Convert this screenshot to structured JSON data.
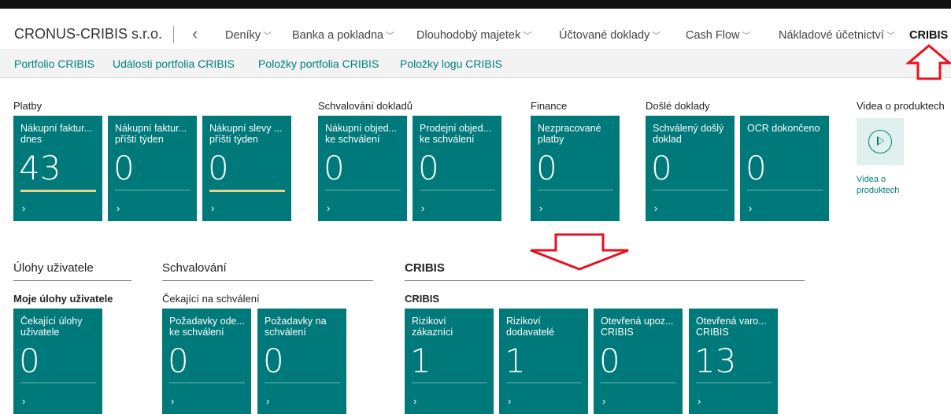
{
  "header": {
    "company": "CRONUS-CRIBIS s.r.o.",
    "back_icon": "chevron-left-icon",
    "menus": [
      {
        "label": "Deníky",
        "active": false
      },
      {
        "label": "Banka a pokladna",
        "active": false
      },
      {
        "label": "Dlouhodobý majetek",
        "active": false
      },
      {
        "label": "Účtované doklady",
        "active": false
      },
      {
        "label": "Cash Flow",
        "active": false
      },
      {
        "label": "Nákladové účetnictví",
        "active": false
      },
      {
        "label": "CRIBIS",
        "active": true
      }
    ]
  },
  "subnav": {
    "links": [
      "Portfolio CRIBIS",
      "Události portfolia CRIBIS",
      "Položky portfolia CRIBIS",
      "Položky logu CRIBIS"
    ]
  },
  "groups": {
    "platby": {
      "title": "Platby",
      "tiles": [
        {
          "label": "Nákupní faktur... dnes",
          "value": "43"
        },
        {
          "label": "Nákupní faktur... příští týden",
          "value": "0"
        },
        {
          "label": "Nákupní slevy ... příští týden",
          "value": "0"
        }
      ]
    },
    "schvalovani_dokladu": {
      "title": "Schvalování dokladů",
      "tiles": [
        {
          "label": "Nákupní objed... ke schválení",
          "value": "0"
        },
        {
          "label": "Prodejní objed... ke schválení",
          "value": "0"
        }
      ]
    },
    "finance": {
      "title": "Finance",
      "tiles": [
        {
          "label": "Nezpracované platby",
          "value": "0"
        }
      ]
    },
    "dosle_doklady": {
      "title": "Došlé doklady",
      "tiles": [
        {
          "label": "Schválený došlý doklad",
          "value": "0"
        },
        {
          "label": "OCR dokončeno",
          "value": "0"
        }
      ]
    },
    "videa": {
      "title": "Videa o produktech",
      "link": "Videa o produktech",
      "icon": "play-icon"
    }
  },
  "sections": {
    "ulohy": {
      "title": "Úlohy uživatele",
      "subtitle": "Moje úlohy uživatele",
      "tiles": [
        {
          "label": "Čekající úlohy uživatele",
          "value": "0"
        }
      ]
    },
    "schvalovani": {
      "title": "Schvalování",
      "subtitle": "Čekající na schválení",
      "tiles": [
        {
          "label": "Požadavky ode... ke schválení",
          "value": "0"
        },
        {
          "label": "Požadavky na schválení",
          "value": "0"
        }
      ]
    },
    "cribis": {
      "title": "CRIBIS",
      "subtitle": "CRIBIS",
      "tiles": [
        {
          "label": "Rizikoví zákazníci",
          "value": "1"
        },
        {
          "label": "Rizikoví dodavatelé",
          "value": "1"
        },
        {
          "label": "Otevřená upoz... CRIBIS",
          "value": "0"
        },
        {
          "label": "Otevřená varo... CRIBIS",
          "value": "13"
        }
      ]
    }
  },
  "tile_arrow": "›",
  "colors": {
    "tile": "#00797a",
    "accent_link": "#00807a",
    "annotation": "#e8101f",
    "progress": "#e8cf8a"
  }
}
